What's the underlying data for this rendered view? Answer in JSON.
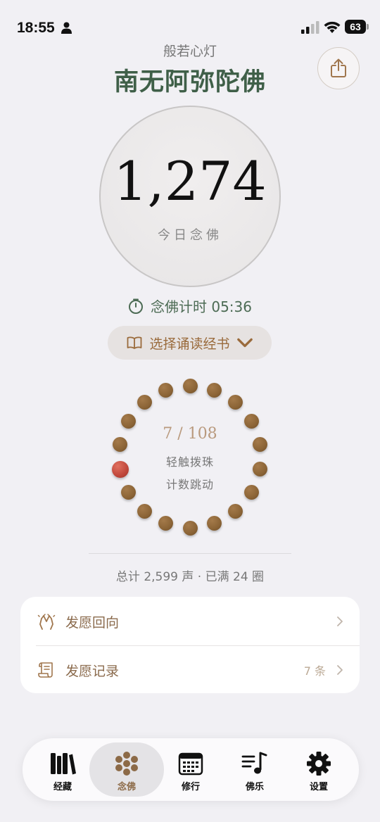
{
  "status_bar": {
    "time": "18:55",
    "battery": "63"
  },
  "header": {
    "subtitle": "般若心灯",
    "title": "南无阿弥陀佛",
    "share_icon": "share-icon"
  },
  "counter": {
    "value": "1,274",
    "label": "今日念佛"
  },
  "timer": {
    "text": "念佛计时 05:36",
    "icon": "timer-icon"
  },
  "book_select": {
    "label": "选择诵读经书",
    "icon": "book-icon"
  },
  "beads": {
    "count": "7 / 108",
    "hint_line1": "轻触拨珠",
    "hint_line2": "计数跳动",
    "total_beads": 18,
    "highlighted_index": 13,
    "colors": {
      "bead": "#8b6436",
      "active": "#c0473b"
    }
  },
  "totals": "总计 2,599 声 · 已满 24 圈",
  "card": {
    "rows": [
      {
        "label": "发愿回向",
        "icon": "praying-hands-icon",
        "badge": ""
      },
      {
        "label": "发愿记录",
        "icon": "scroll-icon",
        "badge": "7 条"
      }
    ]
  },
  "tabbar": {
    "tabs": [
      {
        "label": "经藏",
        "icon": "books-icon",
        "active": false
      },
      {
        "label": "念佛",
        "icon": "beads-icon",
        "active": true
      },
      {
        "label": "修行",
        "icon": "calendar-icon",
        "active": false
      },
      {
        "label": "佛乐",
        "icon": "music-list-icon",
        "active": false
      },
      {
        "label": "设置",
        "icon": "gear-icon",
        "active": false
      }
    ]
  },
  "colors": {
    "background": "#f1f0f4",
    "title": "#3f5f48",
    "accent_brown": "#9a6b3c"
  }
}
